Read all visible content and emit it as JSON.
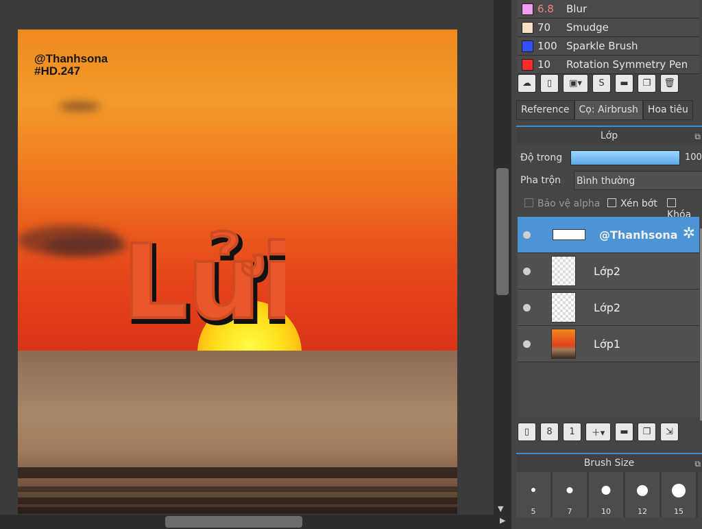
{
  "artwork": {
    "watermark_line1": "@Thanhsona",
    "watermark_line2": "#HD.247",
    "title_text": "Lửi"
  },
  "brushes": [
    {
      "value": "6.8",
      "name": "Blur",
      "color": "#f39cf2"
    },
    {
      "value": "70",
      "name": "Smudge",
      "color": "#f8e0c8"
    },
    {
      "value": "100",
      "name": "Sparkle Brush",
      "color": "#3350ff"
    },
    {
      "value": "10",
      "name": "Rotation Symmetry Pen",
      "color": "#ff2a2a"
    }
  ],
  "tabs": [
    "Reference",
    "Cọ: Airbrush",
    "Hoa tiêu"
  ],
  "layer_panel": {
    "title": "Lớp",
    "opacity_label": "Độ trong",
    "opacity_value": "100",
    "blend_label": "Pha trộn",
    "blend_value": "Bình thường",
    "protect_alpha": "Bảo vệ alpha",
    "clip": "Xén bớt",
    "lock": "Khóa"
  },
  "layers": [
    {
      "name": "@Thanhsona",
      "selected": true
    },
    {
      "name": "Lớp2"
    },
    {
      "name": "Lớp2"
    },
    {
      "name": "Lớp1"
    }
  ],
  "brush_size": {
    "title": "Brush Size",
    "sizes": [
      "5",
      "7",
      "10",
      "12",
      "15"
    ]
  }
}
